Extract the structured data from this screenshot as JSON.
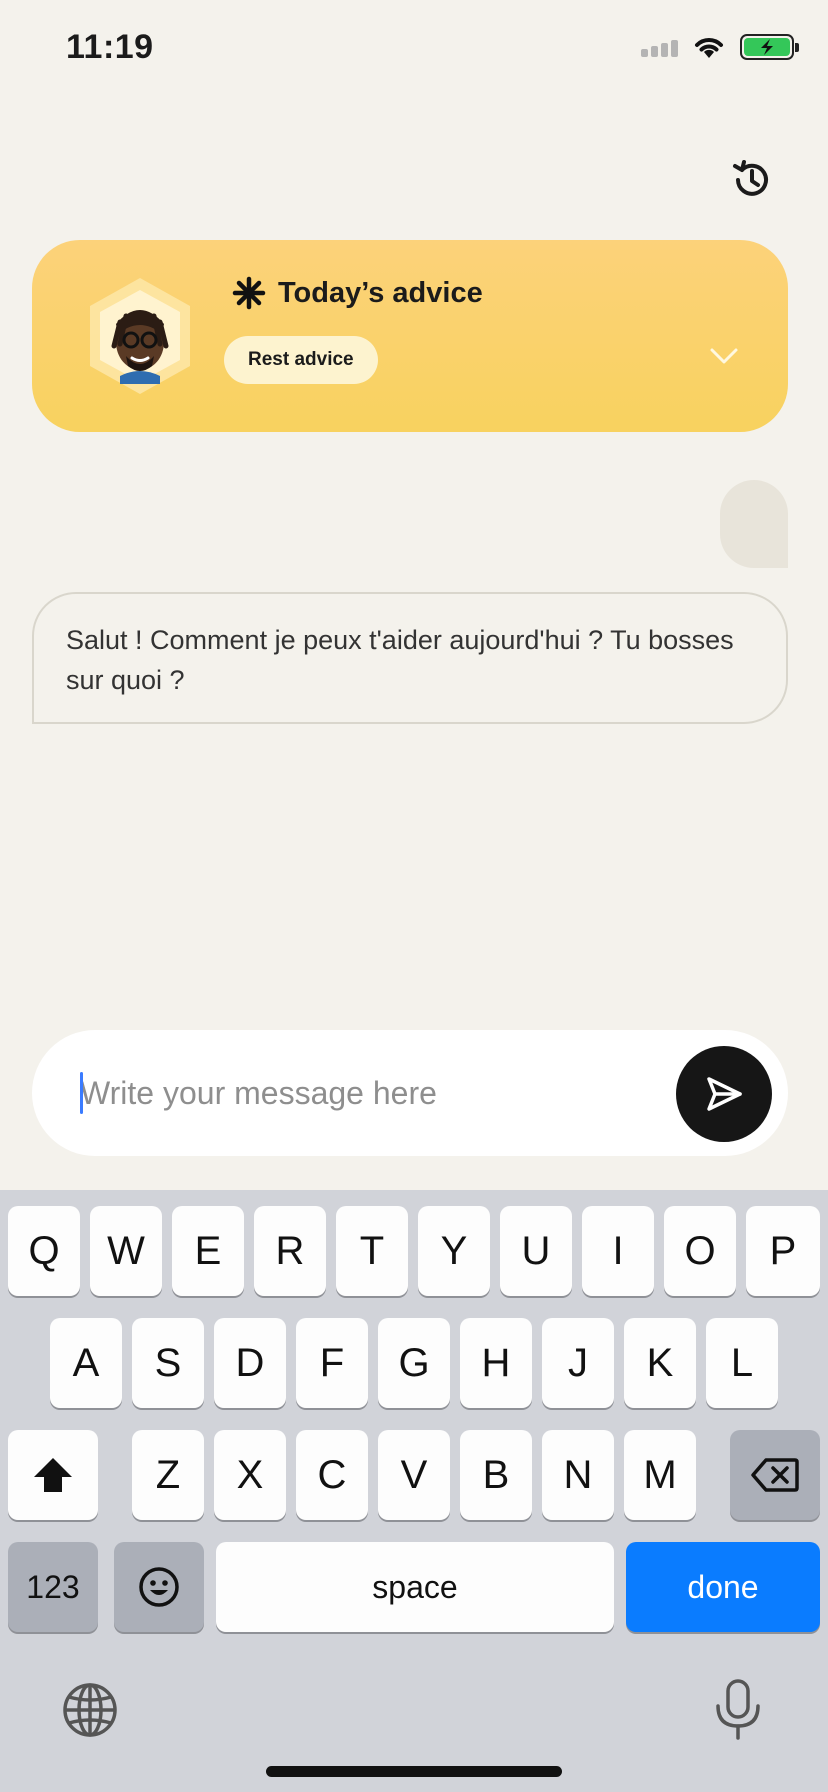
{
  "status": {
    "time": "11:19",
    "signal": "cellular-signal-icon",
    "wifi": "wifi-icon",
    "battery": "battery-charging-icon",
    "battery_color": "#34c759"
  },
  "header": {
    "history_icon": "history-icon"
  },
  "advice": {
    "title": "Today’s advice",
    "chip_label": "Rest advice",
    "card_color": "#f9d065",
    "chip_color": "#fdf3cf"
  },
  "chat": {
    "bot_message": "Salut ! Comment je peux t'aider aujourd'hui ? Tu bosses sur quoi ?",
    "user_message": ""
  },
  "composer": {
    "placeholder": "Write your message here",
    "value": "",
    "send_icon": "send-icon"
  },
  "keyboard": {
    "row1": [
      "Q",
      "W",
      "E",
      "R",
      "T",
      "Y",
      "U",
      "I",
      "O",
      "P"
    ],
    "row2": [
      "A",
      "S",
      "D",
      "F",
      "G",
      "H",
      "J",
      "K",
      "L"
    ],
    "row3": [
      "Z",
      "X",
      "C",
      "V",
      "B",
      "N",
      "M"
    ],
    "numbers_label": "123",
    "space_label": "space",
    "done_label": "done",
    "done_color": "#0a7cff"
  }
}
